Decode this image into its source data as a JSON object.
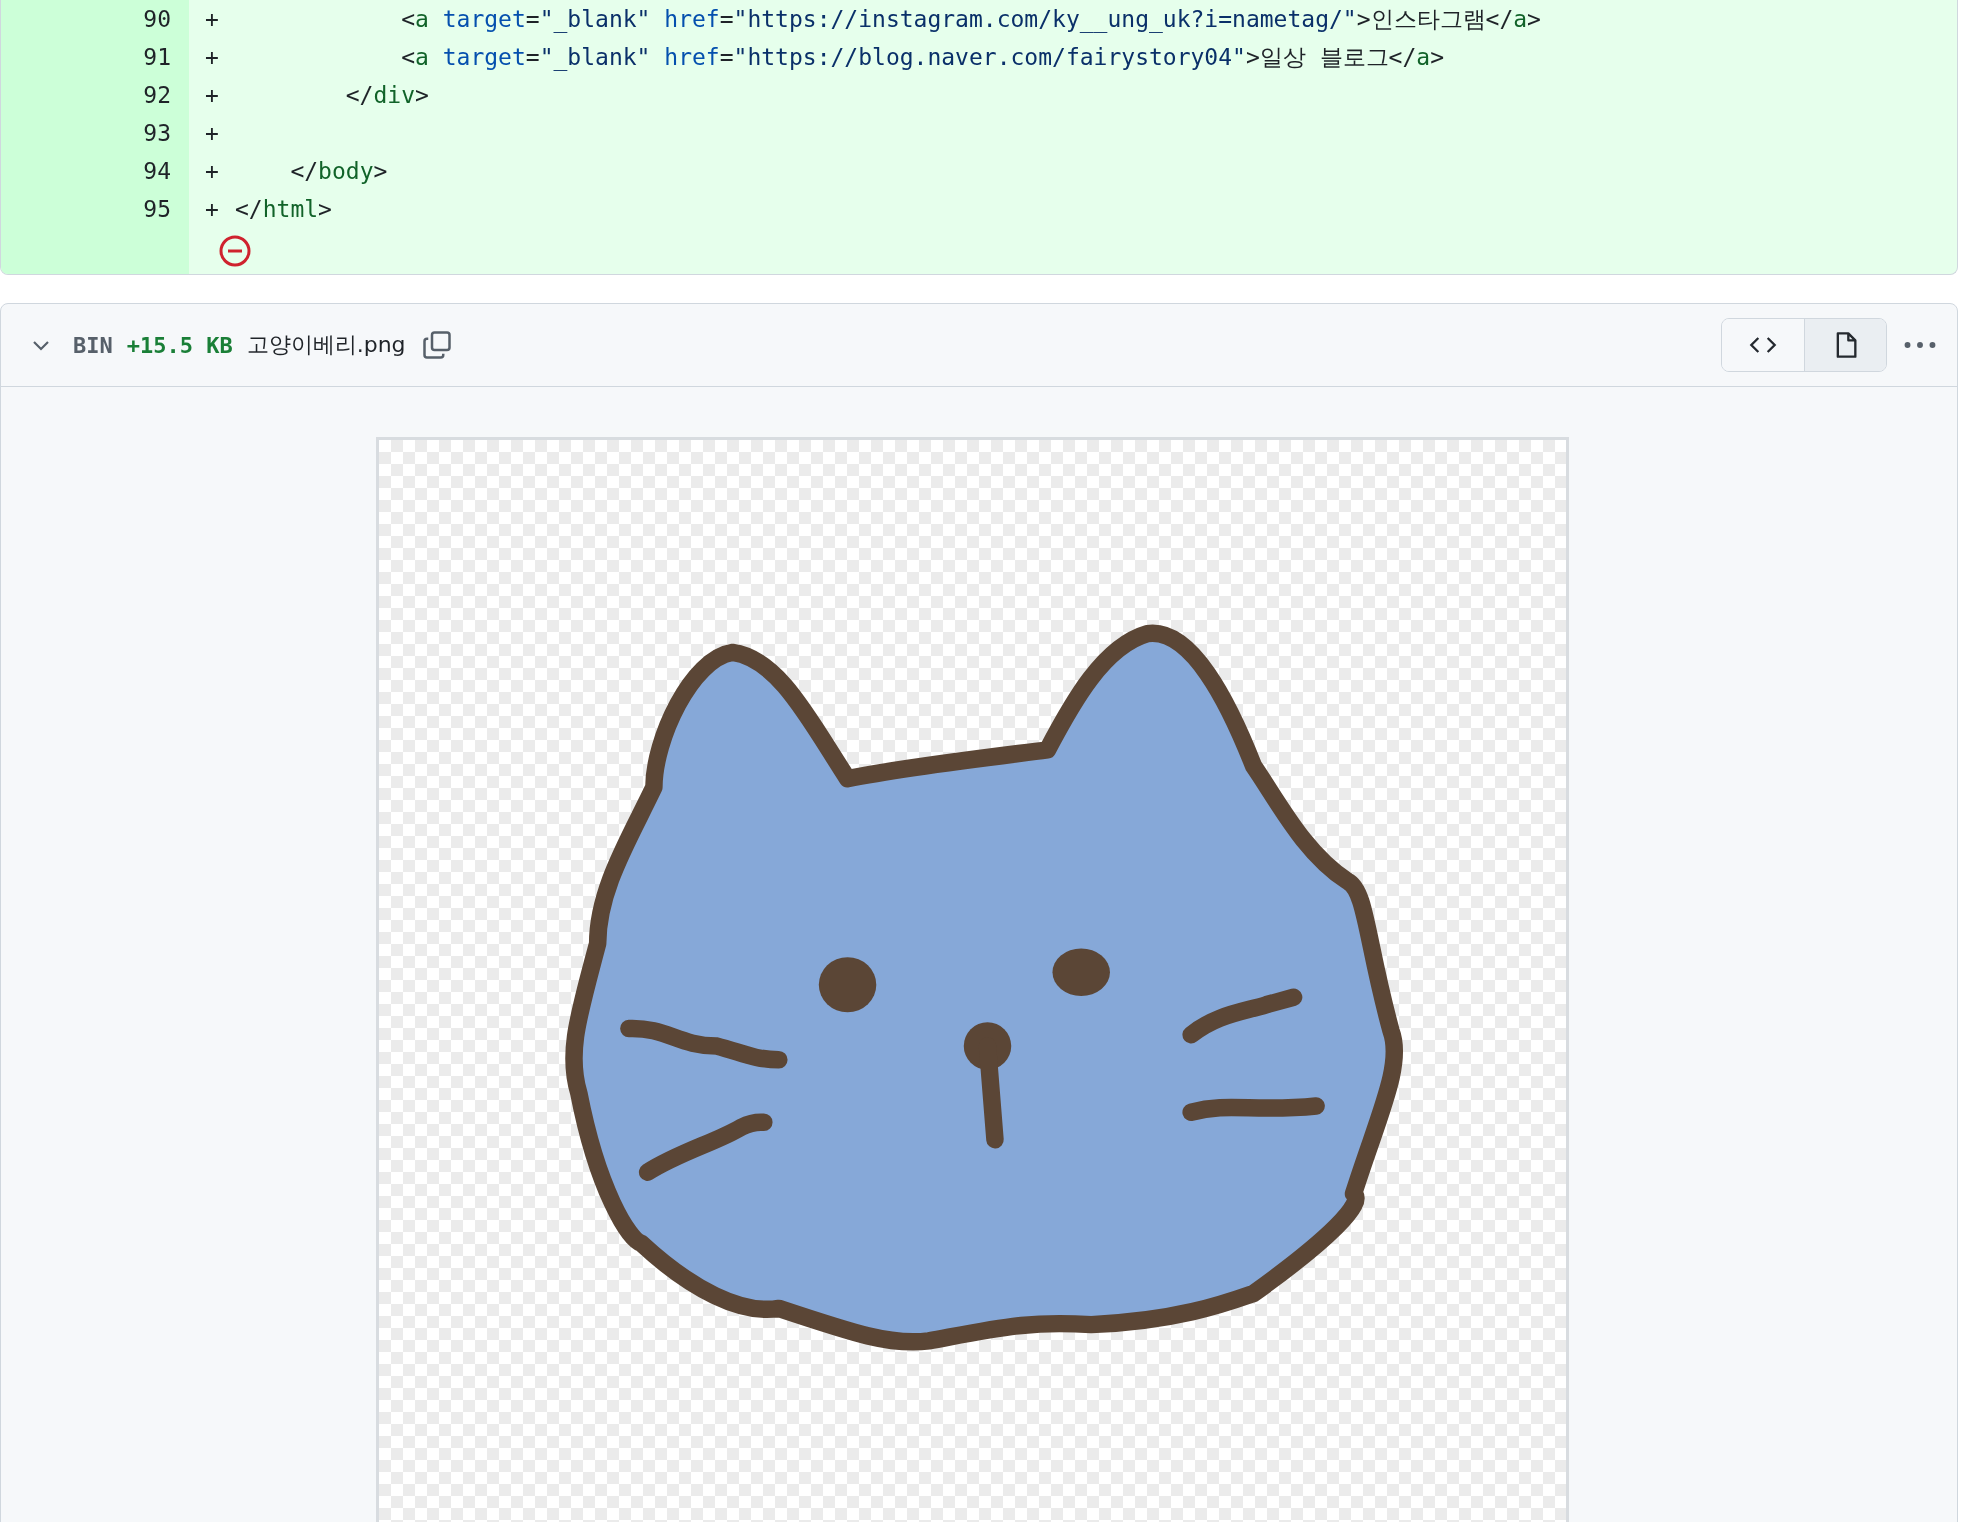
{
  "diff_lines": [
    {
      "number": "90",
      "marker": "+",
      "tokens": [
        {
          "kind": "punct",
          "text": "            <"
        },
        {
          "kind": "tag",
          "text": "a"
        },
        {
          "kind": "attr",
          "text": " target"
        },
        {
          "kind": "punct",
          "text": "="
        },
        {
          "kind": "string",
          "text": "\"_blank\""
        },
        {
          "kind": "attr",
          "text": " href"
        },
        {
          "kind": "punct",
          "text": "="
        },
        {
          "kind": "string",
          "text": "\"https://instagram.com/ky__ung_uk?i=nametag/\""
        },
        {
          "kind": "punct",
          "text": ">인스타그램</"
        },
        {
          "kind": "tag",
          "text": "a"
        },
        {
          "kind": "punct",
          "text": ">"
        }
      ]
    },
    {
      "number": "91",
      "marker": "+",
      "tokens": [
        {
          "kind": "punct",
          "text": "            <"
        },
        {
          "kind": "tag",
          "text": "a"
        },
        {
          "kind": "attr",
          "text": " target"
        },
        {
          "kind": "punct",
          "text": "="
        },
        {
          "kind": "string",
          "text": "\"_blank\""
        },
        {
          "kind": "attr",
          "text": " href"
        },
        {
          "kind": "punct",
          "text": "="
        },
        {
          "kind": "string",
          "text": "\"https://blog.naver.com/fairystory04\""
        },
        {
          "kind": "punct",
          "text": ">일상 블로그</"
        },
        {
          "kind": "tag",
          "text": "a"
        },
        {
          "kind": "punct",
          "text": ">"
        }
      ]
    },
    {
      "number": "92",
      "marker": "+",
      "tokens": [
        {
          "kind": "punct",
          "text": "        </"
        },
        {
          "kind": "tag",
          "text": "div"
        },
        {
          "kind": "punct",
          "text": ">"
        }
      ]
    },
    {
      "number": "93",
      "marker": "+"
    },
    {
      "number": "94",
      "marker": "+",
      "tokens": [
        {
          "kind": "punct",
          "text": "    </"
        },
        {
          "kind": "tag",
          "text": "body"
        },
        {
          "kind": "punct",
          "text": ">"
        }
      ]
    },
    {
      "number": "95",
      "marker": "+",
      "tokens": [
        {
          "kind": "punct",
          "text": "</"
        },
        {
          "kind": "tag",
          "text": "html"
        },
        {
          "kind": "punct",
          "text": ">"
        }
      ]
    }
  ],
  "file": {
    "type": "BIN",
    "size": "+15.5 KB",
    "name": "고양이베리.png",
    "expanded": true,
    "view_buttons": [
      {
        "kind": "code",
        "selected": false
      },
      {
        "kind": "file",
        "selected": true
      }
    ]
  }
}
